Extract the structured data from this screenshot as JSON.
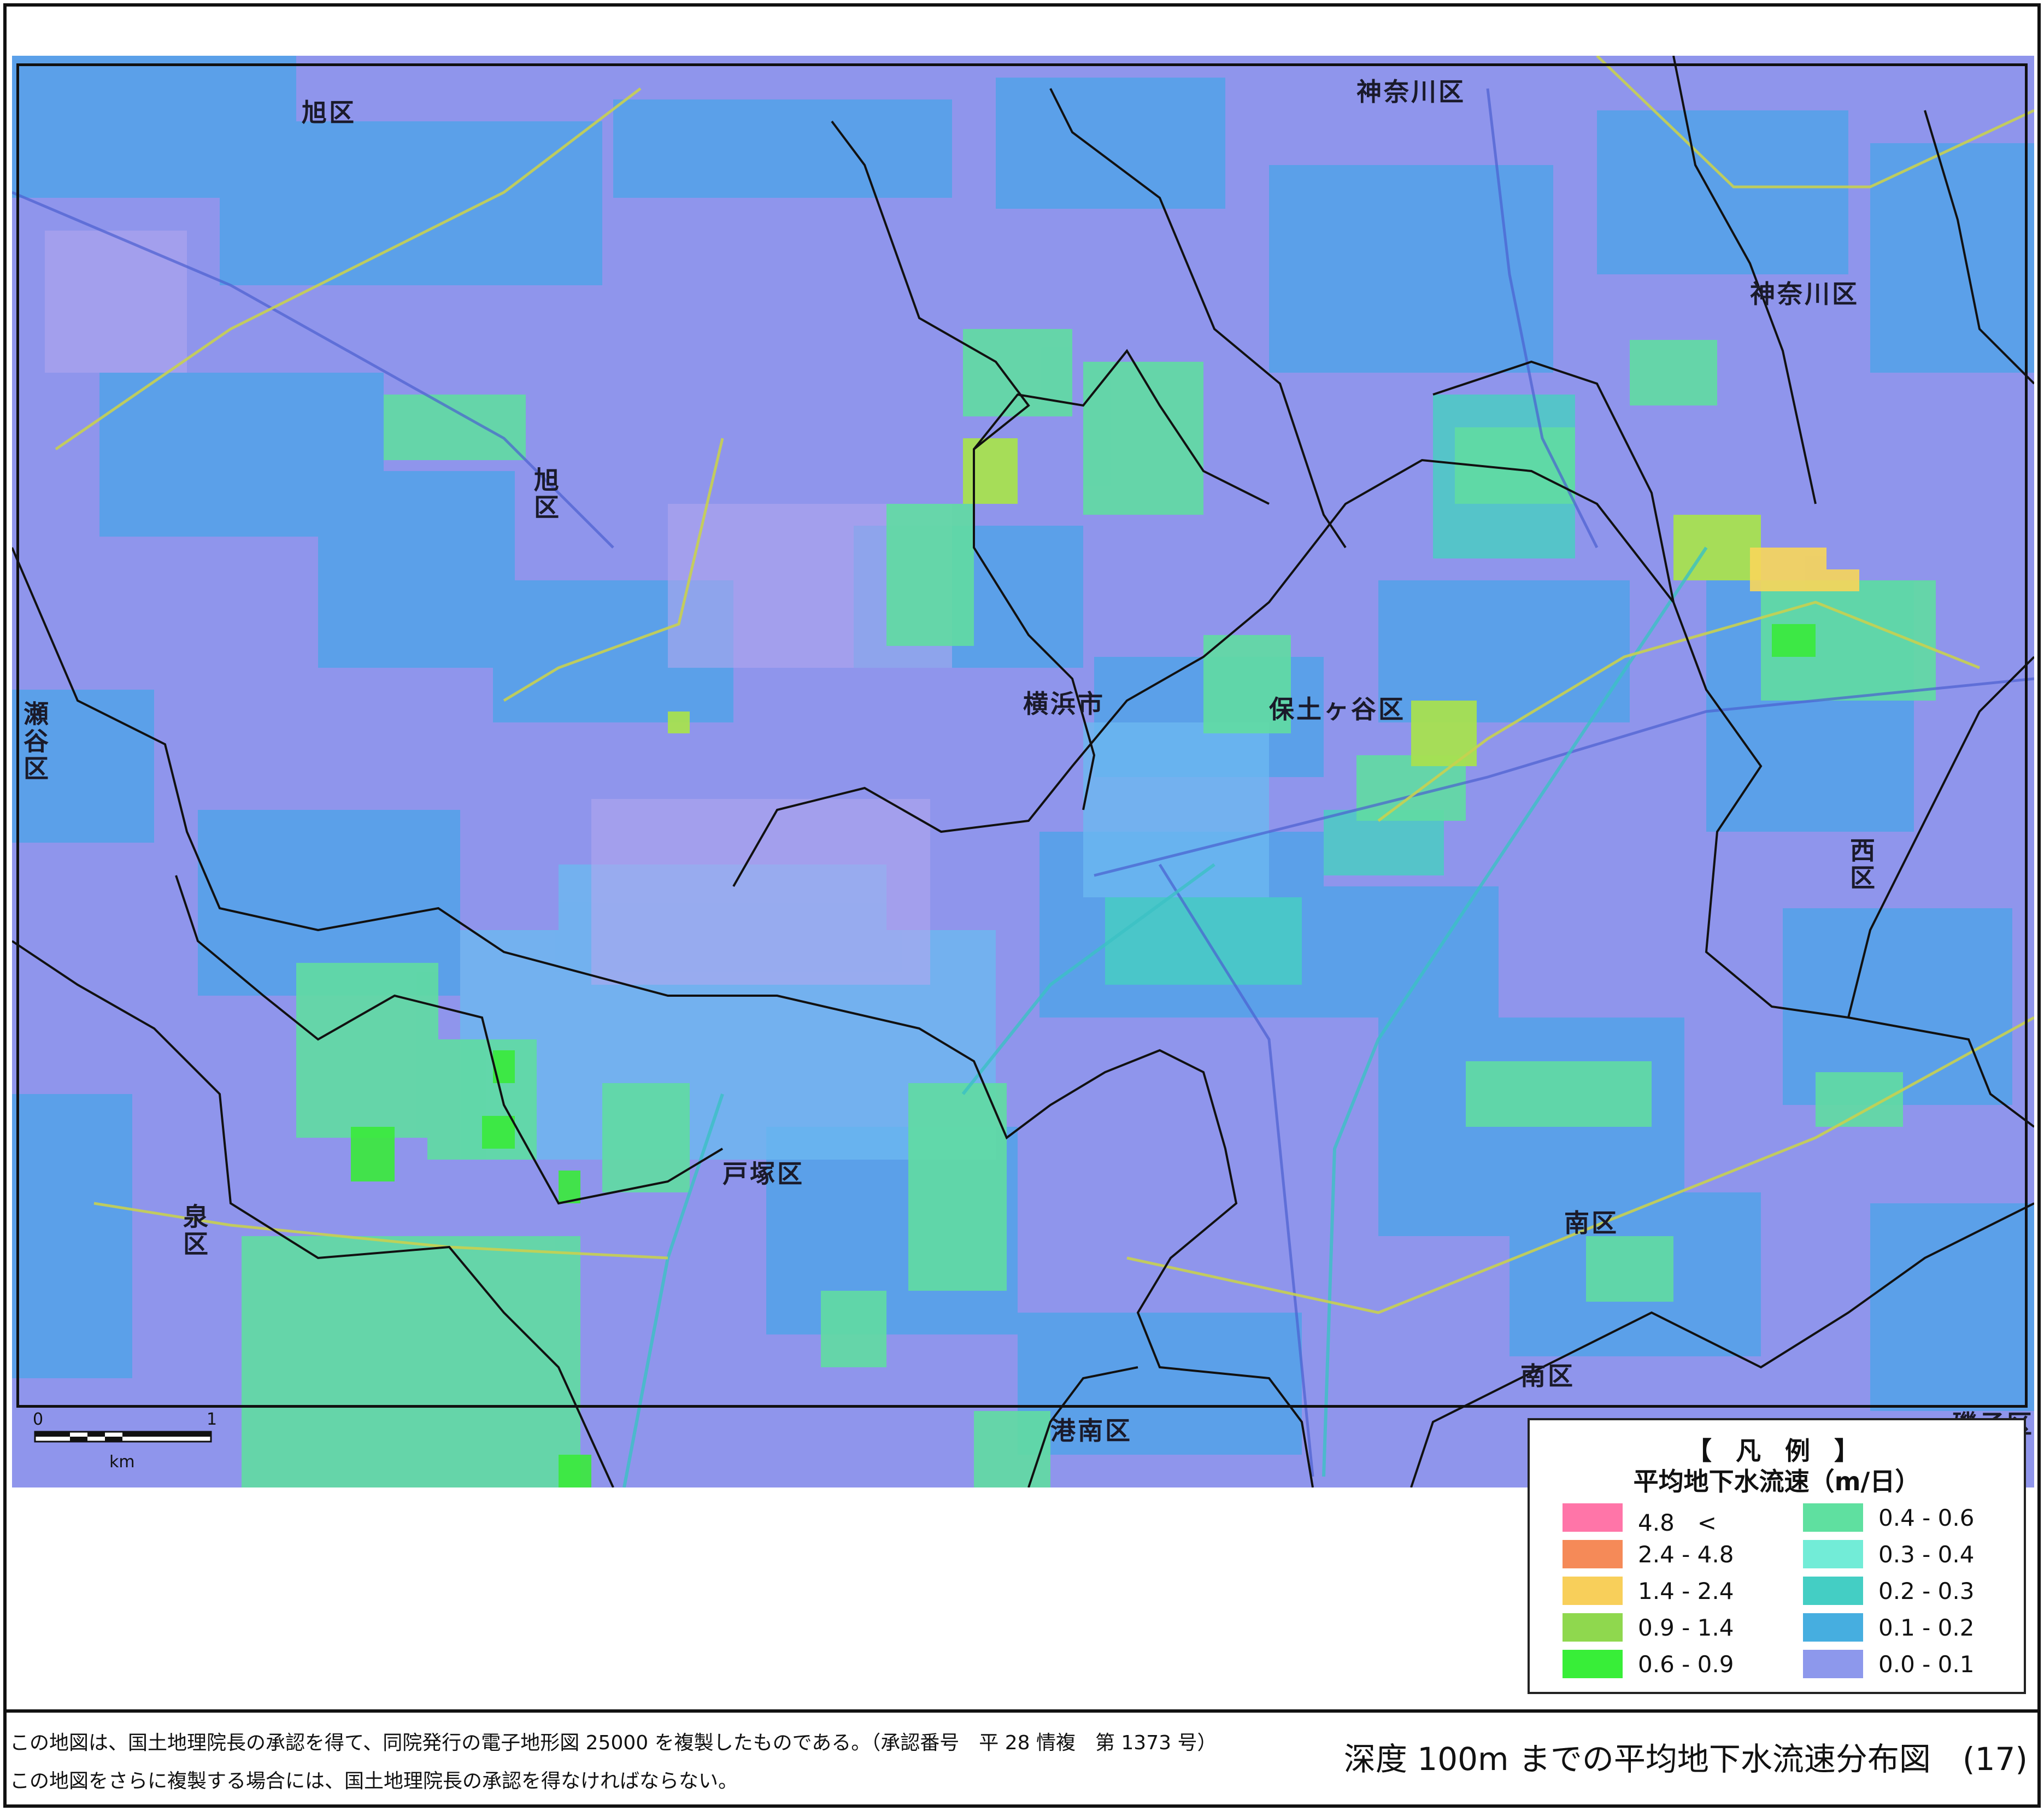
{
  "map": {
    "place_labels": {
      "asahi_top": "旭区",
      "asahi_mid": "旭区",
      "kanagawa_top": "神奈川区",
      "kanagawa_right": "神奈川区",
      "seya": "瀬谷区",
      "yokohama": "横浜市",
      "hodogaya": "保土ヶ谷区",
      "nishi": "西区",
      "totsuka": "戸塚区",
      "izumi": "泉区",
      "minami_1": "南区",
      "minami_2": "南区",
      "konan": "港南区",
      "isogo": "磯子区"
    },
    "scale": {
      "zero": "0",
      "one": "1",
      "unit": "km"
    }
  },
  "legend": {
    "title": "【 凡 例 】",
    "subtitle": "平均地下水流速（m/日）",
    "items": [
      {
        "label": "4.8　<",
        "color": "#ff75a8"
      },
      {
        "label": "2.4 - 4.8",
        "color": "#f58a58"
      },
      {
        "label": "1.4 - 2.4",
        "color": "#f8cf5a"
      },
      {
        "label": "0.9 - 1.4",
        "color": "#8fd84e"
      },
      {
        "label": "0.6 - 0.9",
        "color": "#38ee38"
      },
      {
        "label": "0.4 - 0.6",
        "color": "#5fe0a0"
      },
      {
        "label": "0.3 - 0.4",
        "color": "#72ecd7"
      },
      {
        "label": "0.2 - 0.3",
        "color": "#44cec4"
      },
      {
        "label": "0.1 - 0.2",
        "color": "#46aee0"
      },
      {
        "label": "0.0 - 0.1",
        "color": "#8d98ec"
      }
    ]
  },
  "footer": {
    "note_line1": "この地図は、国土地理院長の承認を得て、同院発行の電子地形図 25000 を複製したものである。（承認番号　平 28 情複　第 1373 号）",
    "note_line2": "この地図をさらに複製する場合には、国土地理院長の承認を得なければならない。",
    "figure_title": "深度 100m までの平均地下水流速分布図　(17)"
  }
}
